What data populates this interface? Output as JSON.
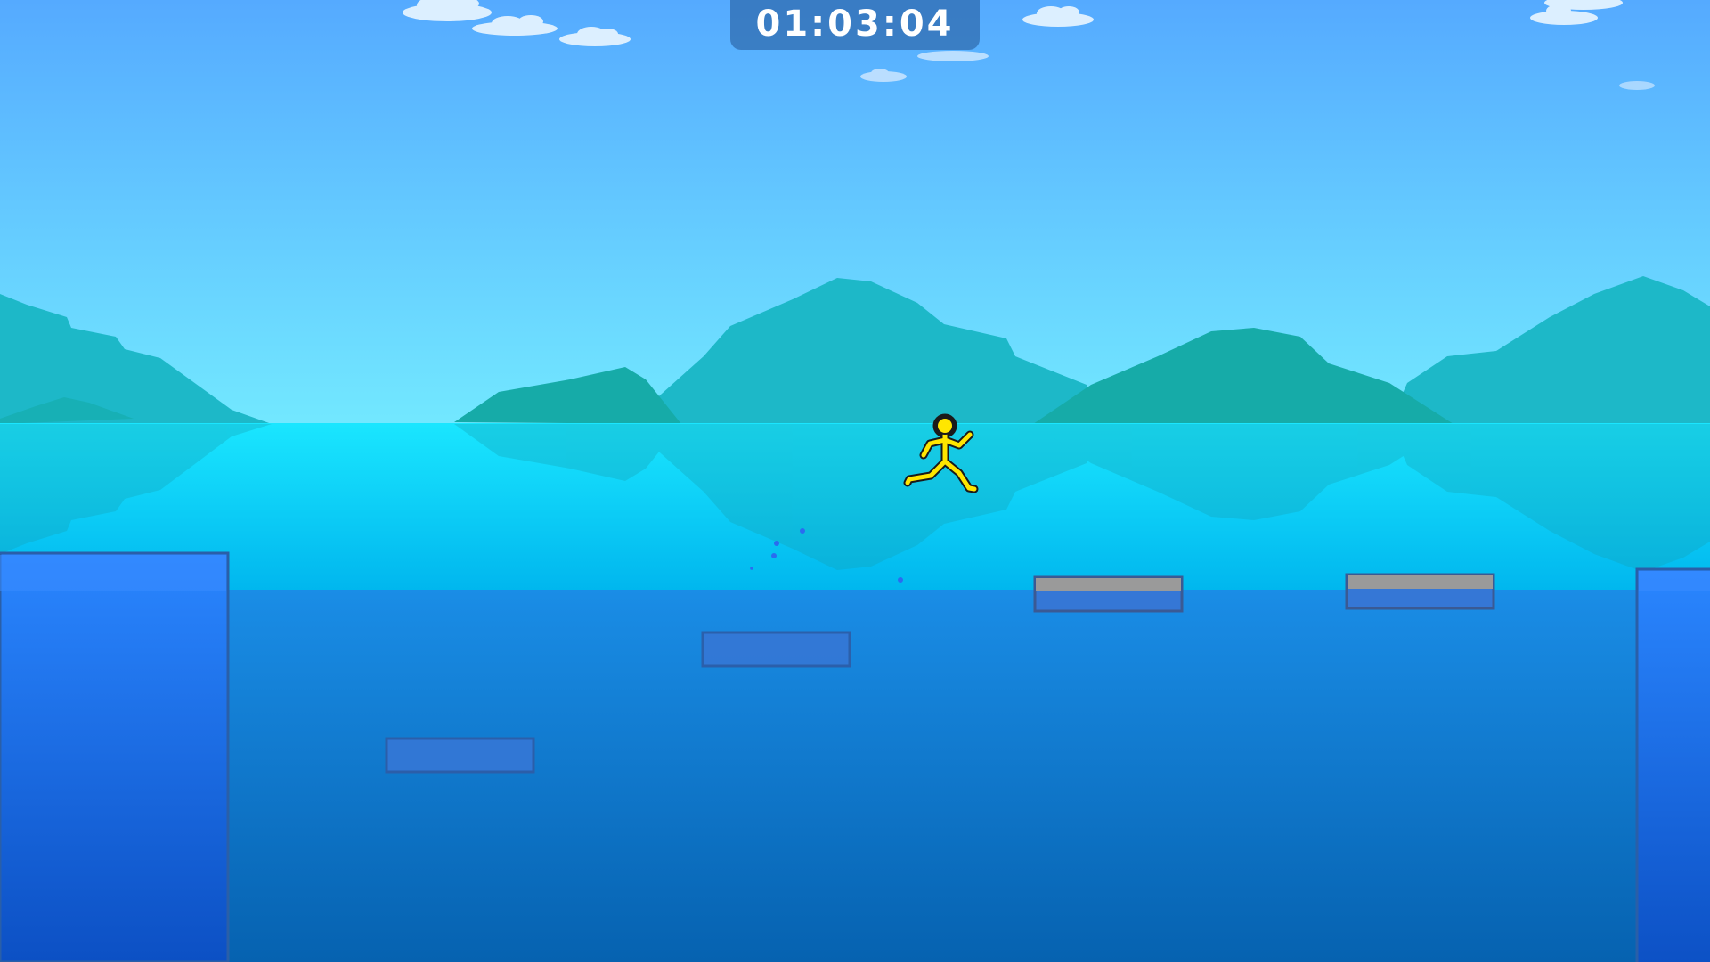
{
  "hud": {
    "timer": "01:03:04"
  },
  "icons": {
    "player": "stickman-runner-icon",
    "cloud": "cloud-icon",
    "mountain": "mountain-icon"
  },
  "colors": {
    "sky_top": "#55aaff",
    "sky_horizon": "#72e8ff",
    "mountain": "#1db8c8",
    "mountain_dark": "#16aba8",
    "lake_surface": "#1ae6ff",
    "lake_mid": "#00c3ee",
    "water_deep_top": "#1a8de6",
    "water_deep_bottom": "#0662b0",
    "wall_top": "#2a86ff",
    "wall_bottom": "#0c50c4",
    "platform_gray": "#9a9a9a",
    "platform_blue": "#3577d6",
    "player_fill": "#ffe600",
    "player_outline": "#1a1a1a"
  }
}
